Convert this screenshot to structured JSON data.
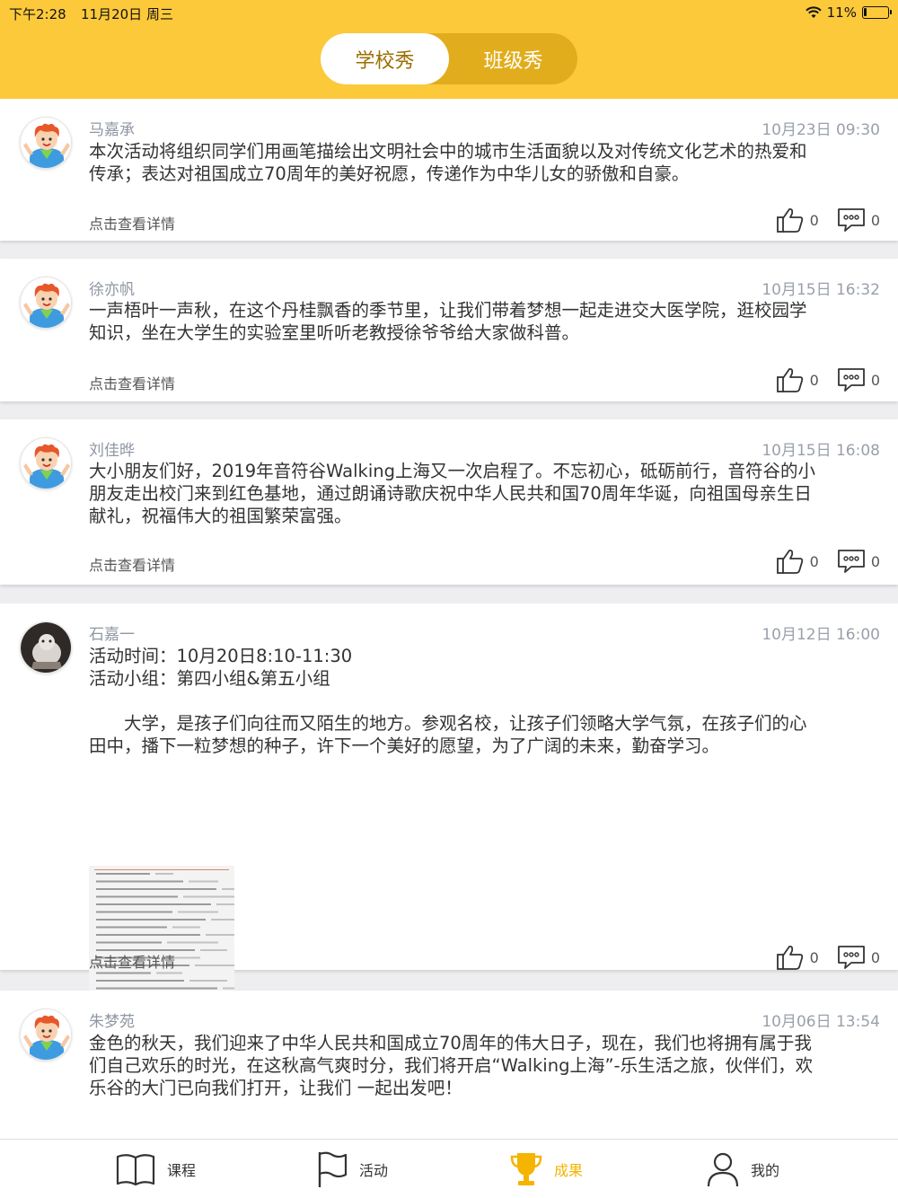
{
  "status_bar": {
    "time": "下午2:28",
    "date": "11月20日 周三",
    "battery": "11%",
    "battery_level": 0.11
  },
  "segment": {
    "active": "学校秀",
    "inactive": "班级秀"
  },
  "posts": [
    {
      "author": "马嘉承",
      "time": "10月23日 09:30",
      "content": [
        "本次活动将组织同学们用画笔描绘出文明社会中的城市生活面貌以及对传统文化艺术的热爱和",
        "传承；表达对祖国成立70周年的美好祝愿，传递作为中华儿女的骄傲和自豪。"
      ],
      "detail": "点击查看详情",
      "likes": "0",
      "comments": "0"
    },
    {
      "author": "徐亦帆",
      "time": "10月15日 16:32",
      "content": [
        "一声梧叶一声秋，在这个丹桂飘香的季节里，让我们带着梦想一起走进交大医学院，逛校园学",
        "知识，坐在大学生的实验室里听听老教授徐爷爷给大家做科普。"
      ],
      "detail": "点击查看详情",
      "likes": "0",
      "comments": "0"
    },
    {
      "author": "刘佳晔",
      "time": "10月15日 16:08",
      "content": [
        "大小朋友们好，2019年音符谷Walking上海又一次启程了。不忘初心，砥砺前行，音符谷的小",
        "朋友走出校门来到红色基地，通过朗诵诗歌庆祝中华人民共和国70周年华诞，向祖国母亲生日",
        "献礼，祝福伟大的祖国繁荣富强。"
      ],
      "detail": "点击查看详情",
      "likes": "0",
      "comments": "0"
    },
    {
      "author": "石嘉一",
      "time": "10月12日 16:00",
      "content": [
        "活动时间：10月20日8:10-11:30",
        "活动小组：第四小组&第五小组",
        "",
        "　　大学，是孩子们向往而又陌生的地方。参观名校，让孩子们领略大学气氛，在孩子们的心",
        "田中，播下一粒梦想的种子，许下一个美好的愿望，为了广阔的未来，勤奋学习。"
      ],
      "detail": "点击查看详情",
      "likes": "0",
      "comments": "0"
    },
    {
      "author": "朱梦苑",
      "time": "10月06日 13:54",
      "content": [
        "金色的秋天，我们迎来了中华人民共和国成立70周年的伟大日子，现在，我们也将拥有属于我",
        "们自己欢乐的时光，在这秋高气爽时分，我们将开启“Walking上海”-乐生活之旅，伙伴们，欢",
        "乐谷的大门已向我们打开，让我们 一起出发吧！"
      ]
    }
  ],
  "tabs": [
    {
      "label": "课程",
      "icon": "book-icon"
    },
    {
      "label": "活动",
      "icon": "flag-icon"
    },
    {
      "label": "成果",
      "icon": "trophy-icon",
      "active": true
    },
    {
      "label": "我的",
      "icon": "person-icon"
    }
  ],
  "colors": {
    "header": "#fcc93b",
    "segment_bg": "#e2ad1c",
    "active_tab": "#f4b400"
  }
}
